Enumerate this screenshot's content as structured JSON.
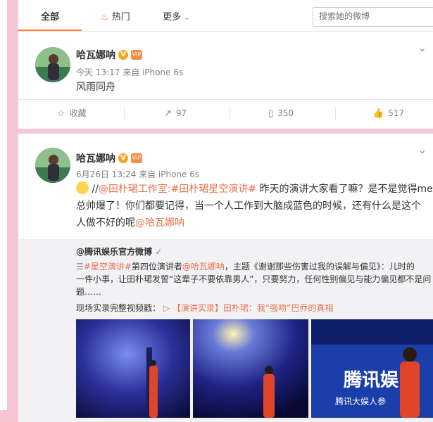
{
  "tabs": [
    {
      "label": "全部"
    },
    {
      "label": "热门"
    },
    {
      "label": "更多"
    }
  ],
  "search": {
    "placeholder": "搜索她的微博"
  },
  "post1": {
    "author": "哈瓦娜呐",
    "meta": "今天 13:17 来自 iPhone 6s",
    "text": "风雨同舟",
    "actions": {
      "collect": "收藏",
      "repost": "97",
      "comment": "350",
      "like": "517"
    }
  },
  "post2": {
    "author": "哈瓦娜呐",
    "meta": "6月26日 13:24 来自 iPhone 6s",
    "text_prefix": " //",
    "mention1": "@田朴珺工作室",
    "colon": ":",
    "topic1": "#田朴珺星空演讲#",
    "line1_rest": " 昨天的演讲大家看了嘛？是不是觉得me",
    "line2": "总帅爆了！你们都要记得，当一个人工作到大脑成蓝色的时候，还有什么是这个",
    "line3_prefix": "人做不好的呢",
    "mention_self": "@哈瓦娜呐",
    "repost": {
      "author": "@腾讯娱乐官方微博",
      "topic": "#星空演讲#",
      "l1_mid": "第四位演讲者",
      "l1_mention": "@哈瓦娜呐",
      "l1_rest": "，主题《谢谢那些伤害过我的误解与偏见》：儿时的",
      "line2": "一件小事，让田朴珺发誓“这辈子不要依靠男人”，只要努力，任何性别偏见与能力偏见都不是问",
      "line3": "题……",
      "video_label": "现场实录完整视频戳：",
      "video_link": "【演讲实录】田朴珺：我“强吻”巴乔的真相"
    },
    "watermark": "腾讯娱",
    "watermark_sub": "腾讯大娱人参"
  },
  "colors": {
    "accent": "#fa7d3c",
    "link": "#eb7350",
    "background": "#f7c6d4"
  },
  "icons": [
    "flame-icon",
    "chevron-down-icon",
    "star-icon",
    "repost-icon",
    "comment-icon",
    "thumbs-up-icon",
    "verified-icon",
    "vip-icon",
    "smile-emoji-icon",
    "play-icon"
  ]
}
